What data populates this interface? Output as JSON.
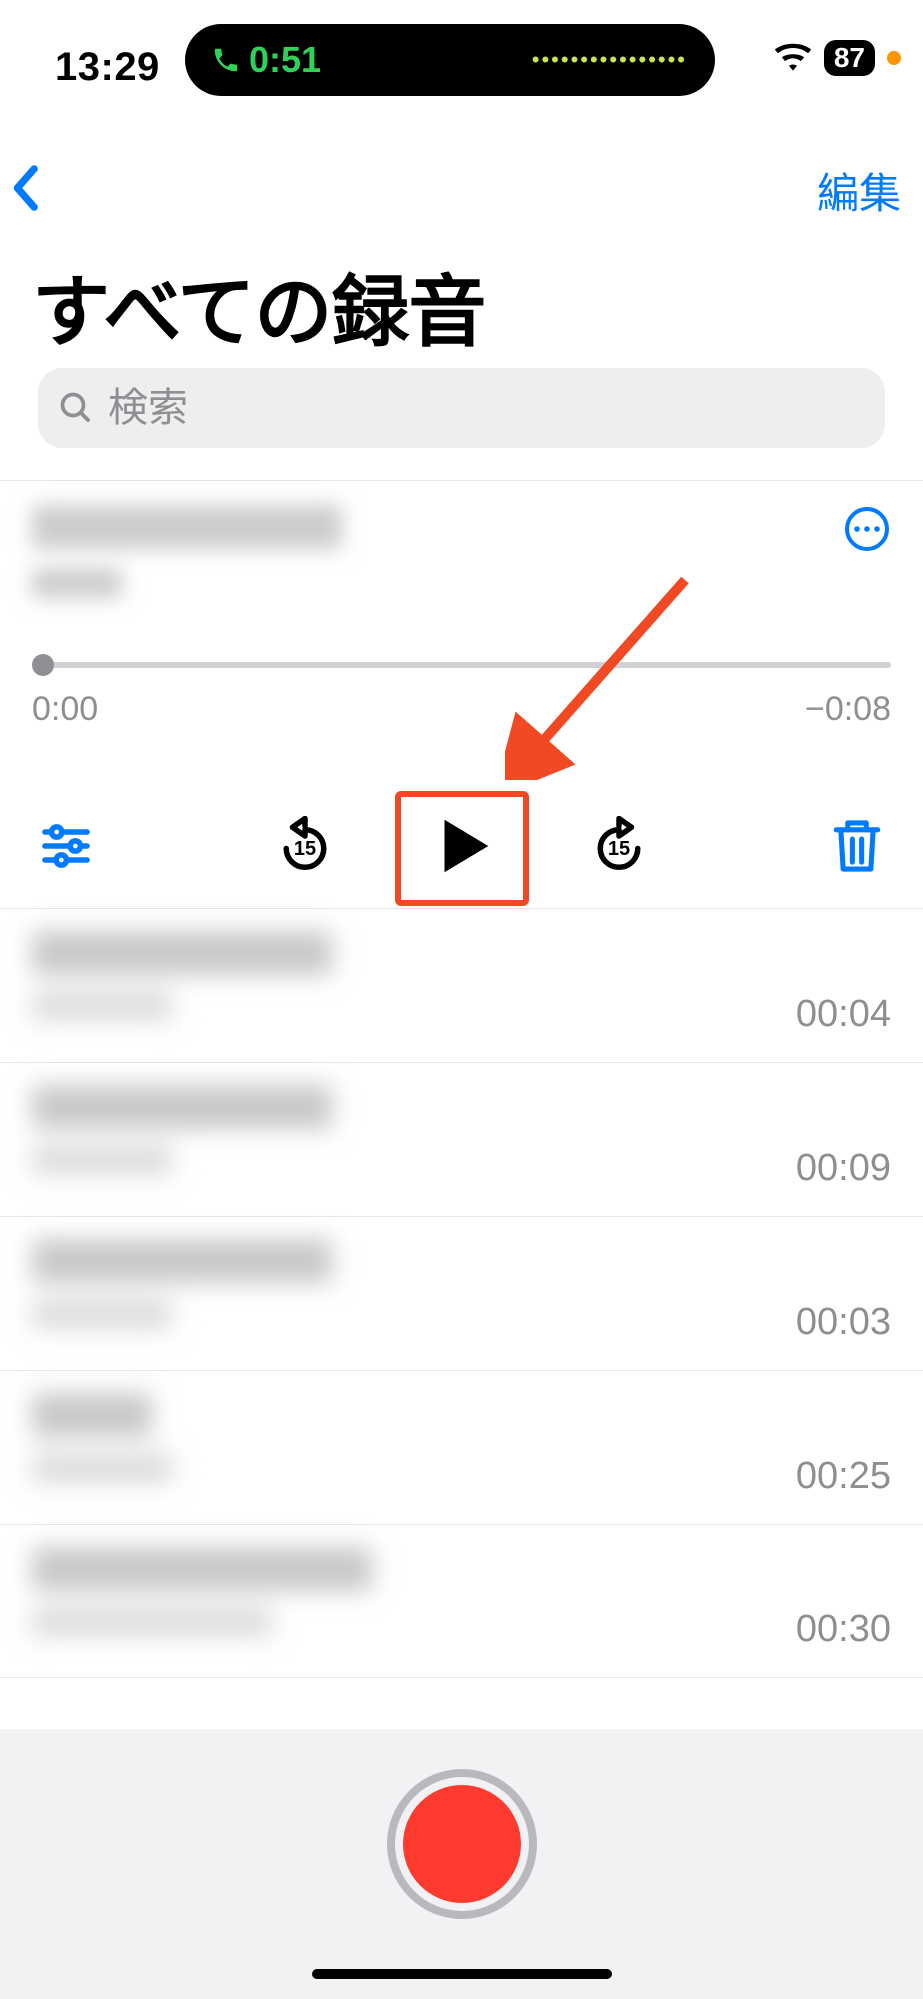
{
  "status": {
    "time": "13:29",
    "call_duration": "0:51",
    "battery_percent": "87"
  },
  "nav": {
    "edit_label": "編集"
  },
  "page": {
    "title": "すべての録音"
  },
  "search": {
    "placeholder": "検索"
  },
  "selected_recording": {
    "current_time": "0:00",
    "remaining_time": "−0:08",
    "skip_seconds": "15"
  },
  "recordings": [
    {
      "duration": "00:04"
    },
    {
      "duration": "00:09"
    },
    {
      "duration": "00:03"
    },
    {
      "duration": "00:25"
    },
    {
      "duration": "00:30"
    }
  ],
  "colors": {
    "accent_blue": "#007aff",
    "highlight_red": "#f04923",
    "record_red": "#ff3b30"
  }
}
